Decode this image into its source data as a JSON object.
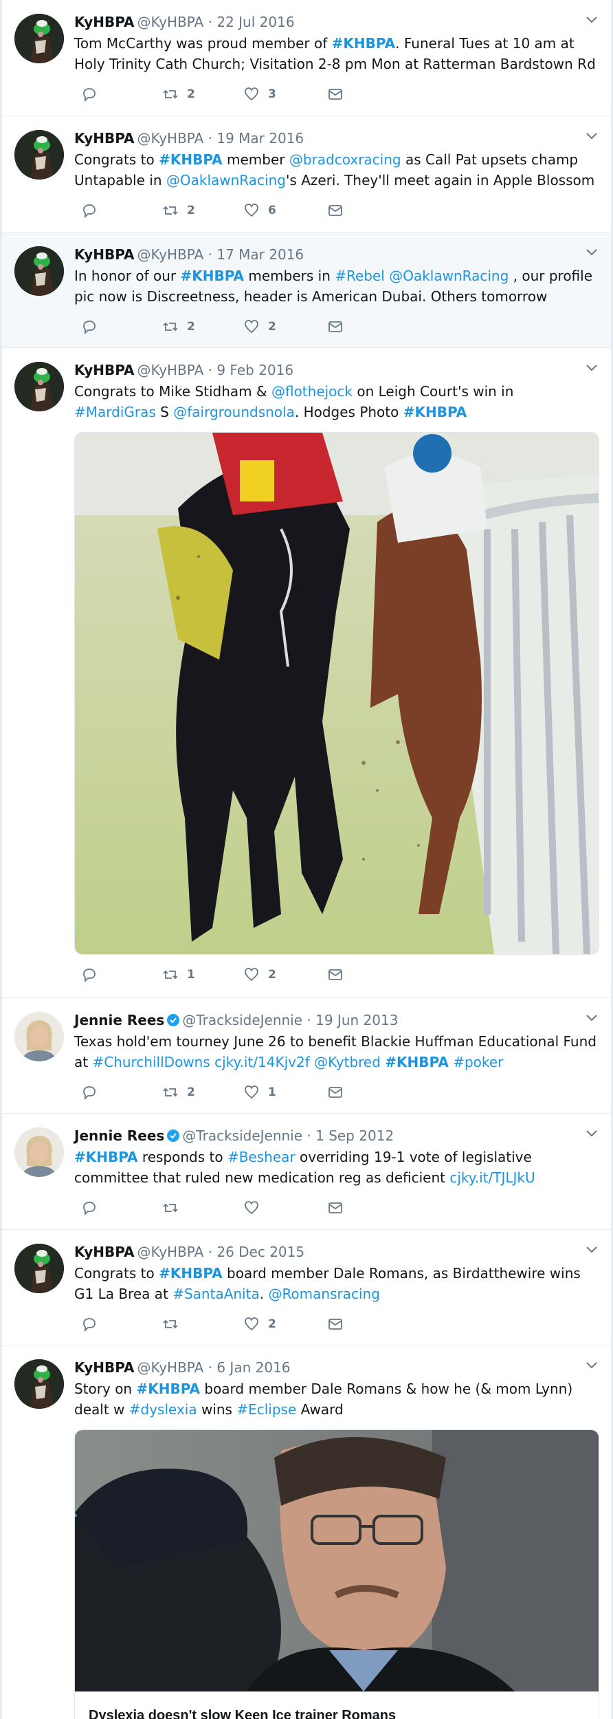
{
  "tweets": [
    {
      "name": "KyHBPA",
      "handle": "@KyHBPA",
      "date": "22 Jul 2016",
      "text1": "Tom McCarthy was proud member of ",
      "tag1": "#KHBPA",
      "text2": ". Funeral Tues at 10 am at Holy Trinity Cath Church; Visitation 2-8 pm Mon at Ratterman Bardstown Rd",
      "retweets": "2",
      "likes": "3"
    },
    {
      "name": "KyHBPA",
      "handle": "@KyHBPA",
      "date": "19 Mar 2016",
      "text1": "Congrats to ",
      "tag1": "#KHBPA",
      "text2": " member ",
      "mention1": "@bradcoxracing",
      "text3": " as Call Pat upsets champ Untapable in ",
      "mention2": "@OaklawnRacing",
      "text4": "'s Azeri. They'll meet again in Apple Blossom",
      "retweets": "2",
      "likes": "6"
    },
    {
      "name": "KyHBPA",
      "handle": "@KyHBPA",
      "date": "17 Mar 2016",
      "text1": "In honor of our ",
      "tag1": "#KHBPA",
      "text2": " members in ",
      "tag2": "#Rebel",
      "mention1": "@OaklawnRacing",
      "text3": " , our profile pic now is Discreetness, header is American Dubai. Others tomorrow",
      "retweets": "2",
      "likes": "2"
    },
    {
      "name": "KyHBPA",
      "handle": "@KyHBPA",
      "date": "9 Feb 2016",
      "text1": "Congrats to Mike Stidham & ",
      "mention1": "@flothejock",
      "text2": " on Leigh Court's win in ",
      "tag1": "#MardiGras",
      "text3": " S ",
      "mention2": "@fairgroundsnola",
      "text4": ". Hodges Photo ",
      "tag2": "#KHBPA",
      "retweets": "1",
      "likes": "2"
    },
    {
      "name": "Jennie Rees",
      "handle": "@TracksideJennie",
      "date": "19 Jun 2013",
      "text1": "Texas hold'em tourney June 26 to benefit Blackie Huffman Educational Fund at ",
      "tag1": "#ChurchillDowns",
      "link1": "cjky.it/14Kjv2f",
      "mention1": "@Kytbred",
      "tag2": "#KHBPA",
      "tag3": "#poker",
      "retweets": "2",
      "likes": "1"
    },
    {
      "name": "Jennie Rees",
      "handle": "@TracksideJennie",
      "date": "1 Sep 2012",
      "tag1": "#KHBPA",
      "text1": " responds to ",
      "tag2": "#Beshear",
      "text2": " overriding 19-1 vote of legislative committee that ruled new medication reg as deficient ",
      "link1": "cjky.it/TJLJkU"
    },
    {
      "name": "KyHBPA",
      "handle": "@KyHBPA",
      "date": "26 Dec 2015",
      "text1": "Congrats to ",
      "tag1": "#KHBPA",
      "text2": " board member Dale Romans, as Birdatthewire wins G1 La Brea at ",
      "tag2": "#SantaAnita",
      "text3": ". ",
      "mention1": "@Romansracing",
      "likes": "2"
    },
    {
      "name": "KyHBPA",
      "handle": "@KyHBPA",
      "date": "6 Jan 2016",
      "text1": "Story on ",
      "tag1": "#KHBPA",
      "text2": " board member Dale Romans & how he (& mom Lynn) dealt w ",
      "tag2": "#dyslexia",
      "text3": " wins ",
      "tag3": "#Eclipse",
      "text4": " Award",
      "card_title": "Dyslexia doesn't slow Keen Ice trainer Romans"
    }
  ],
  "separator": " · "
}
